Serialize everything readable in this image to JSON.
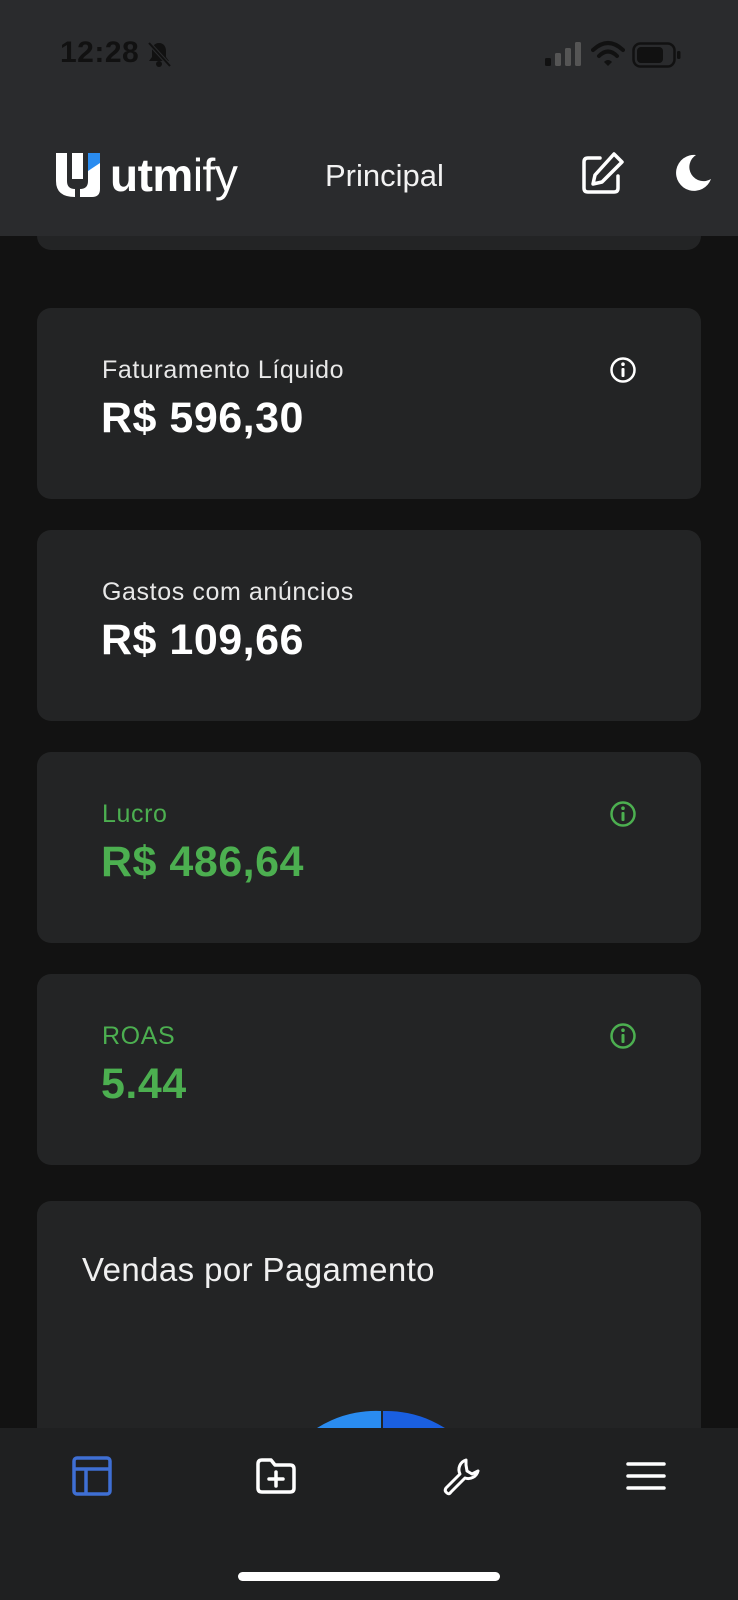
{
  "status_bar": {
    "time": "12:28",
    "icons": [
      "bell-muted-icon",
      "signal-icon",
      "wifi-icon",
      "battery-icon"
    ]
  },
  "header": {
    "logo_bold": "utm",
    "logo_light": "ify",
    "title": "Principal",
    "actions": [
      "edit-icon",
      "moon-icon"
    ]
  },
  "metrics": [
    {
      "label": "Faturamento Líquido",
      "value": "R$ 596,30",
      "info": true,
      "color": "#ffffff"
    },
    {
      "label": "Gastos com anúncios",
      "value": "R$ 109,66",
      "info": false,
      "color": "#ffffff"
    },
    {
      "label": "Lucro",
      "value": "R$ 486,64",
      "info": true,
      "color": "#4caf50"
    },
    {
      "label": "ROAS",
      "value": "5.44",
      "info": true,
      "color": "#4caf50"
    }
  ],
  "payment_chart": {
    "title": "Vendas por Pagamento",
    "segment_colors": [
      "#2a8cf0",
      "#1a5fe0"
    ]
  },
  "bottom_nav": {
    "items": [
      "dashboard-icon",
      "folder-plus-icon",
      "wrench-icon",
      "menu-icon"
    ],
    "active_color": "#3f6fd4"
  }
}
